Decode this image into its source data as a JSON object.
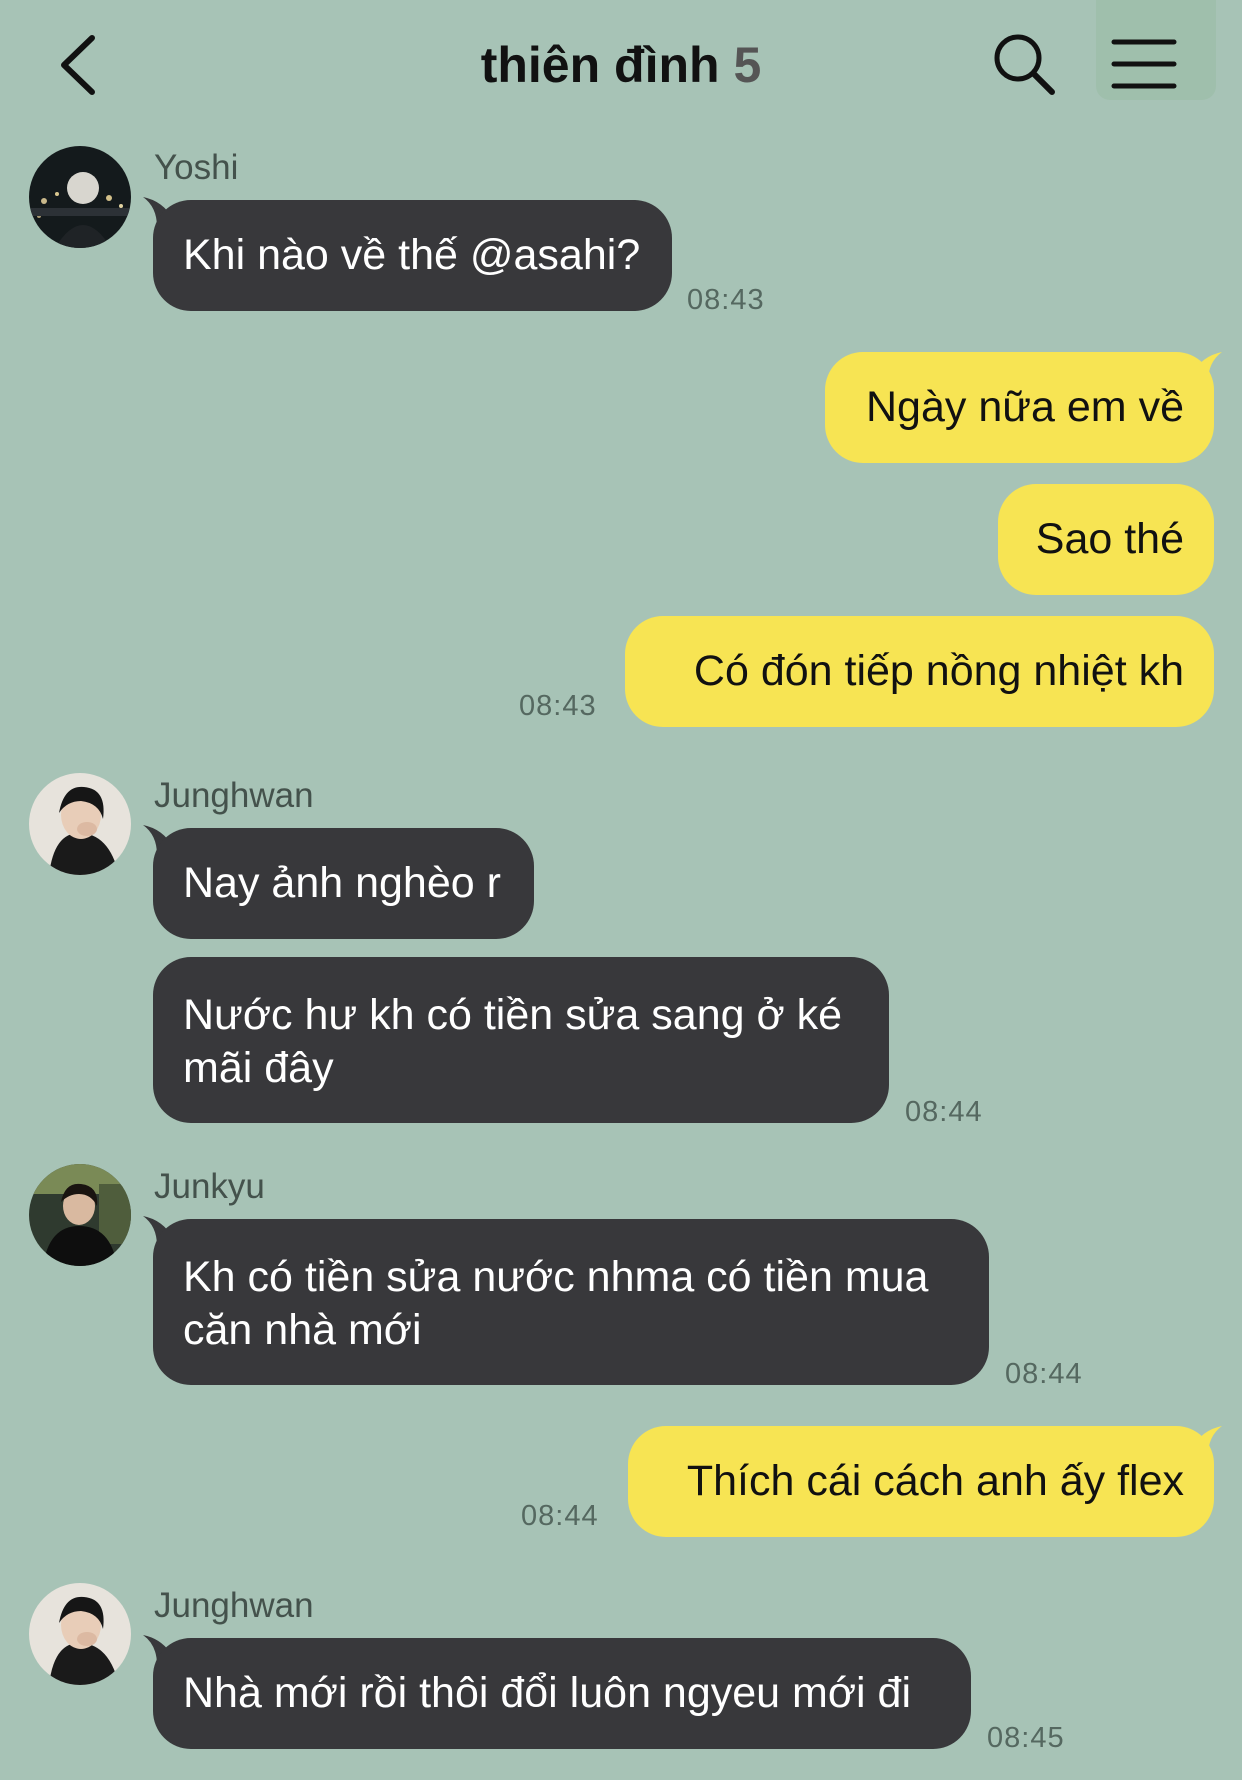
{
  "header": {
    "title": "thiên đình",
    "member_count": "5"
  },
  "messages": [
    {
      "sender": "Yoshi",
      "text": "Khi nào về thế @asahi?",
      "time": "08:43"
    },
    {
      "text": "Ngày nữa em về"
    },
    {
      "text": "Sao thé"
    },
    {
      "text": "Có đón tiếp nồng nhiệt kh",
      "time": "08:43"
    },
    {
      "sender": "Junghwan",
      "text": "Nay ảnh nghèo r"
    },
    {
      "text": "Nước hư kh có tiền sửa sang ở ké mãi đây",
      "time": "08:44"
    },
    {
      "sender": "Junkyu",
      "text": "Kh có tiền sửa nước nhma có tiền mua căn nhà mới",
      "time": "08:44"
    },
    {
      "text": "Thích cái cách anh ấy flex",
      "time": "08:44"
    },
    {
      "sender": "Junghwan",
      "text": "Nhà mới rồi thôi đổi luôn ngyeu mới đi",
      "time": "08:45"
    }
  ]
}
